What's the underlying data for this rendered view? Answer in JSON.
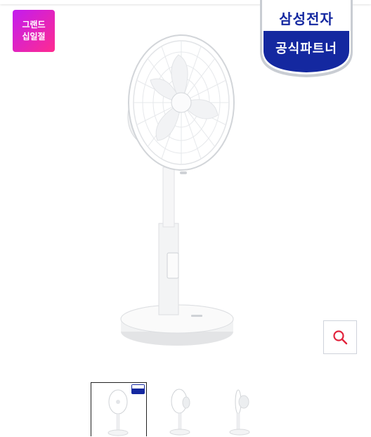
{
  "promo_badge": {
    "line1": "그랜드",
    "line2": "십일절",
    "gradient": [
      "#c21cf0",
      "#ff2b8f"
    ]
  },
  "partner_badge": {
    "line1": "삼성전자",
    "line2": "공식파트너",
    "brand_color": "#1428a0"
  },
  "main_image": {
    "icon": "standing-electric-fan"
  },
  "zoom_button": {
    "icon": "magnifier-icon",
    "icon_color": "#e2233c"
  },
  "thumbnails": [
    {
      "icon": "fan-front-view",
      "selected": true,
      "has_partner_badge": true
    },
    {
      "icon": "fan-angled-view",
      "selected": false,
      "has_partner_badge": false
    },
    {
      "icon": "fan-side-view",
      "selected": false,
      "has_partner_badge": false
    }
  ]
}
